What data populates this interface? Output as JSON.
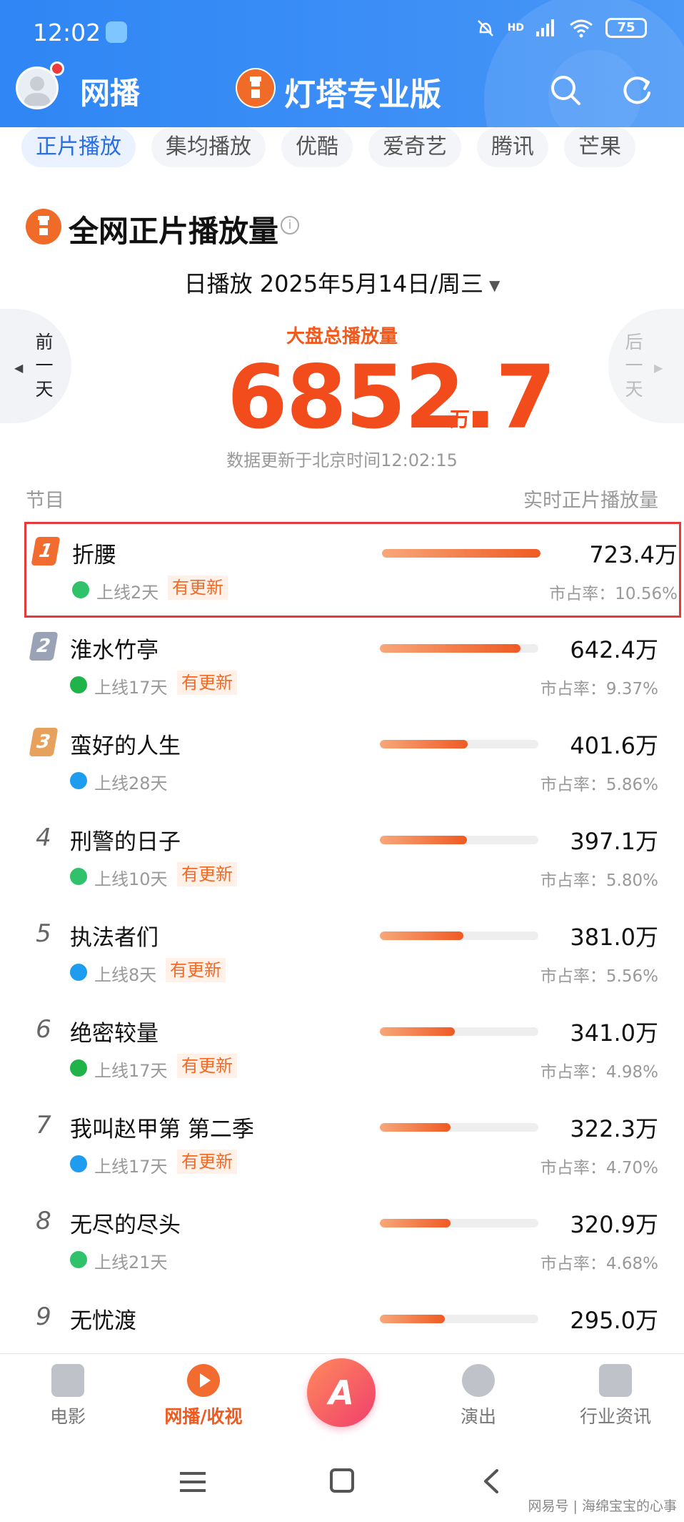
{
  "status": {
    "time": "12:02",
    "network": "HD",
    "battery": "75"
  },
  "header": {
    "tab_label": "网播",
    "brand_title": "灯塔专业版"
  },
  "platform_tabs": [
    "正片播放",
    "集均播放",
    "优酷",
    "爱奇艺",
    "腾讯",
    "芒果"
  ],
  "section": {
    "title": "全网正片播放量",
    "date_selector": "日播放 2025年5月14日/周三",
    "prev_label": "前一天",
    "next_label": "后一天",
    "total_label": "大盘总播放量",
    "total_value": "6852.7",
    "total_unit": "万",
    "update_time": "数据更新于北京时间12:02:15"
  },
  "columns": {
    "left": "节目",
    "right": "实时正片播放量"
  },
  "programs": [
    {
      "rank": "1",
      "title": "折腰",
      "platform": "tencent",
      "days": "上线2天",
      "updated": "有更新",
      "value": "723.4万",
      "share": "市占率：10.56%",
      "fraction": 1.0
    },
    {
      "rank": "2",
      "title": "淮水竹亭",
      "platform": "iqiyi",
      "days": "上线17天",
      "updated": "有更新",
      "value": "642.4万",
      "share": "市占率：9.37%",
      "fraction": 0.888
    },
    {
      "rank": "3",
      "title": "蛮好的人生",
      "platform": "youku",
      "days": "上线28天",
      "updated": "",
      "value": "401.6万",
      "share": "市占率：5.86%",
      "fraction": 0.555
    },
    {
      "rank": "4",
      "title": "刑警的日子",
      "platform": "tencent",
      "days": "上线10天",
      "updated": "有更新",
      "value": "397.1万",
      "share": "市占率：5.80%",
      "fraction": 0.549
    },
    {
      "rank": "5",
      "title": "执法者们",
      "platform": "youku",
      "days": "上线8天",
      "updated": "有更新",
      "value": "381.0万",
      "share": "市占率：5.56%",
      "fraction": 0.527
    },
    {
      "rank": "6",
      "title": "绝密较量",
      "platform": "iqiyi",
      "days": "上线17天",
      "updated": "有更新",
      "value": "341.0万",
      "share": "市占率：4.98%",
      "fraction": 0.471
    },
    {
      "rank": "7",
      "title": "我叫赵甲第 第二季",
      "platform": "youku",
      "days": "上线17天",
      "updated": "有更新",
      "value": "322.3万",
      "share": "市占率：4.70%",
      "fraction": 0.446
    },
    {
      "rank": "8",
      "title": "无尽的尽头",
      "platform": "tencent",
      "days": "上线21天",
      "updated": "",
      "value": "320.9万",
      "share": "市占率：4.68%",
      "fraction": 0.444
    },
    {
      "rank": "9",
      "title": "无忧渡",
      "platform": "",
      "days": "",
      "updated": "",
      "value": "295.0万",
      "share": "",
      "fraction": 0.408
    }
  ],
  "bottom_nav": [
    "电影",
    "网播/收视",
    "演出",
    "行业资讯"
  ],
  "watermark": "网易号 | 海绵宝宝的心事",
  "colors": {
    "header_blue": "#2f86f4",
    "accent_orange": "#f24b1c",
    "highlight_border": "#e33a3a"
  }
}
